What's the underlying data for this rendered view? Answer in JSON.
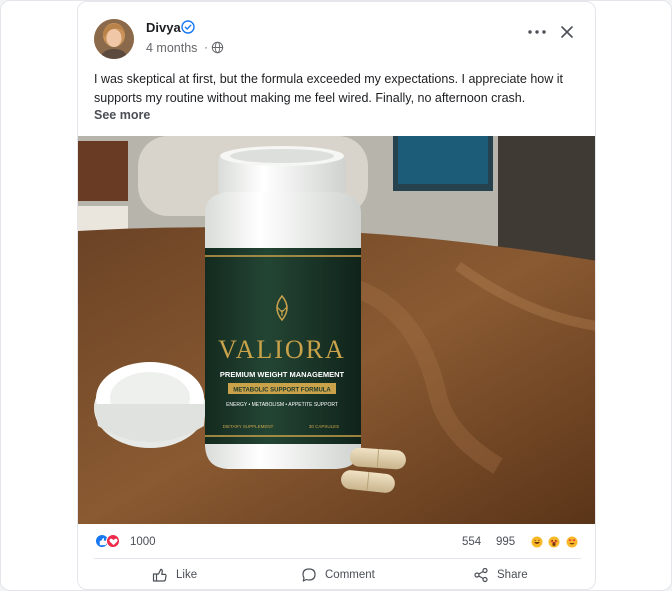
{
  "post": {
    "author": "Divya",
    "time": "4 months",
    "separator": "·",
    "text": "I was skeptical at first, but the formula exceeded my expectations. I appreciate how it supports my routine without making me feel wired. Finally, no afternoon crash.",
    "see_more": "See more"
  },
  "photo": {
    "brand": "VALIORA",
    "line1": "PREMIUM WEIGHT MANAGEMENT",
    "line2": "METABOLIC SUPPORT FORMULA",
    "line3": "ENERGY • METABOLISM • APPETITE SUPPORT",
    "line4a": "DIETARY SUPPLEMENT",
    "line4b": "30 CAPSULES"
  },
  "stats": {
    "reactions": "1000",
    "comments": "554",
    "shares": "995"
  },
  "actions": {
    "like": "Like",
    "comment": "Comment",
    "share": "Share"
  },
  "icons": [
    "verified-icon",
    "globe-icon",
    "more-icon",
    "close-icon",
    "like-icon",
    "comment-icon",
    "share-icon"
  ],
  "colors": {
    "accent": "#1877f2",
    "love": "#f02849",
    "bottle_label": "#1f3a2c",
    "gold": "#c9a24a"
  }
}
